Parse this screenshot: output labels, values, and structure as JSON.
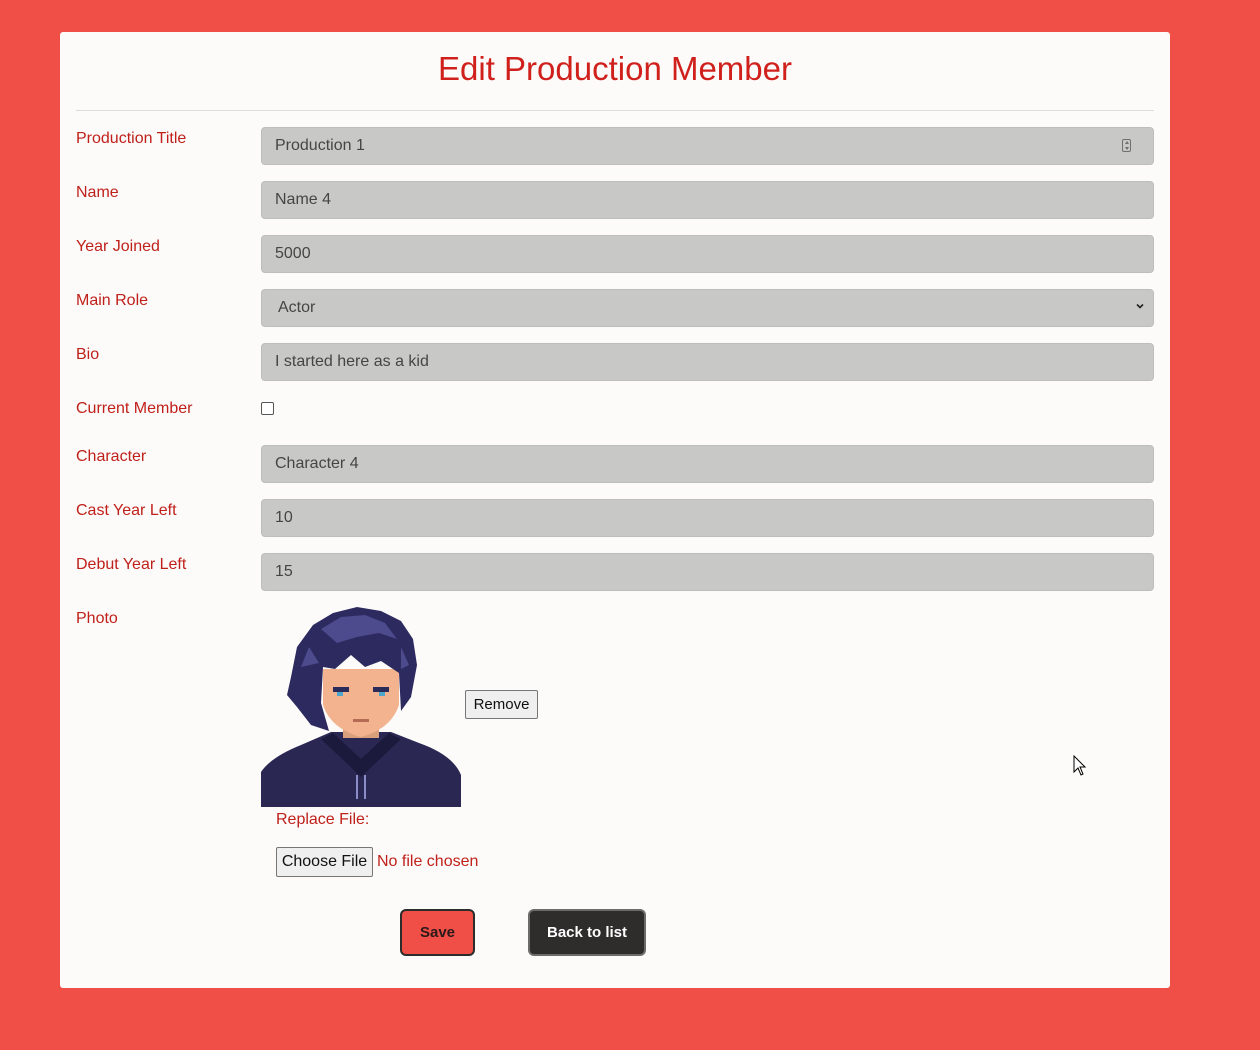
{
  "page": {
    "title": "Edit Production Member"
  },
  "form": {
    "production_title": {
      "label": "Production Title",
      "value": "Production 1"
    },
    "name": {
      "label": "Name",
      "value": "Name 4"
    },
    "year_joined": {
      "label": "Year Joined",
      "value": "5000"
    },
    "main_role": {
      "label": "Main Role",
      "value": "Actor"
    },
    "bio": {
      "label": "Bio",
      "value": "I started here as a kid"
    },
    "current_member": {
      "label": "Current Member",
      "checked": false
    },
    "character": {
      "label": "Character",
      "value": "Character 4"
    },
    "cast_year_left": {
      "label": "Cast Year Left",
      "value": "10"
    },
    "debut_year_left": {
      "label": "Debut Year Left",
      "value": "15"
    },
    "photo": {
      "label": "Photo",
      "remove_label": "Remove",
      "replace_label": "Replace File:",
      "choose_label": "Choose File",
      "no_file_text": "No file chosen"
    }
  },
  "actions": {
    "save_label": "Save",
    "back_label": "Back to list"
  },
  "colors": {
    "background": "#ef4f47",
    "accent_text": "#c0201a",
    "field_bg": "#c8c8c7",
    "dark_button": "#2f2c2c"
  }
}
